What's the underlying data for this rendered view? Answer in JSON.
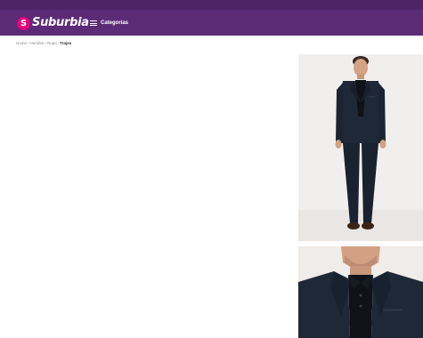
{
  "header": {
    "logo_badge": "S",
    "logo_text": "Suburbia",
    "categories_label": "Categorías",
    "menu_icon": "hamburger-icon"
  },
  "breadcrumb": {
    "items": [
      "Home",
      "Hombre",
      "Ropa"
    ],
    "separator": "›",
    "current": "Trajes"
  },
  "colors": {
    "topbar": "#4e2467",
    "header": "#5c2b78",
    "logo_badge": "#e4007c",
    "suit": "#1f2836"
  }
}
